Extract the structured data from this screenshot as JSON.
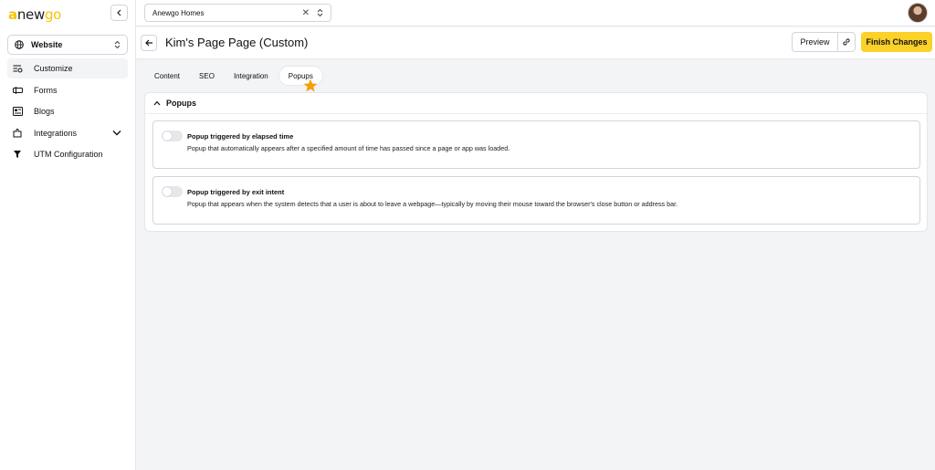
{
  "logo": {
    "text_a": "a",
    "text_b": "new",
    "text_c": "go"
  },
  "sidebar": {
    "site_select": "Website",
    "items": [
      {
        "label": "Customize",
        "icon": "customize-icon",
        "active": true
      },
      {
        "label": "Forms",
        "icon": "forms-icon"
      },
      {
        "label": "Blogs",
        "icon": "blogs-icon"
      },
      {
        "label": "Integrations",
        "icon": "integrations-icon",
        "expandable": true
      },
      {
        "label": "UTM Configuration",
        "icon": "utm-icon"
      }
    ]
  },
  "topbar": {
    "account": "Anewgo Homes"
  },
  "header": {
    "title": "Kim's Page Page (Custom)",
    "preview": "Preview",
    "finish": "Finish Changes"
  },
  "tabs": [
    "Content",
    "SEO",
    "Integration",
    "Popups"
  ],
  "active_tab": "Popups",
  "panel": {
    "title": "Popups",
    "cards": [
      {
        "title": "Popup triggered by elapsed time",
        "description": "Popup that automatically appears after a specified amount of time has passed since a page or app was loaded.",
        "enabled": false
      },
      {
        "title": "Popup triggered by exit intent",
        "description": "Popup that appears when the system detects that a user is about to leave a webpage—typically by moving their mouse toward the browser's close button or address bar.",
        "enabled": false
      }
    ]
  },
  "colors": {
    "accent": "#fbd12a",
    "star": "#f59e0b",
    "logo": "#f5c400"
  }
}
